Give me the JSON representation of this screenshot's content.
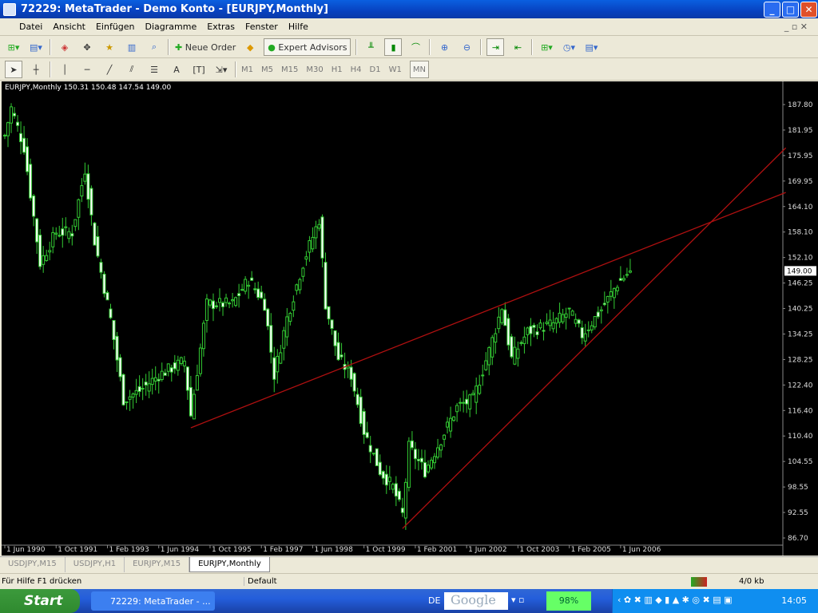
{
  "window": {
    "title": "72229: MetaTrader - Demo Konto - [EURJPY,Monthly]"
  },
  "menu": [
    "Datei",
    "Ansicht",
    "Einfügen",
    "Diagramme",
    "Extras",
    "Fenster",
    "Hilfe"
  ],
  "toolbar": {
    "new_order": "Neue Order",
    "expert_advisors": "Expert Advisors",
    "text_tool": "A",
    "timeframes": [
      "M1",
      "M5",
      "M15",
      "M30",
      "H1",
      "H4",
      "D1",
      "W1",
      "MN"
    ],
    "active_timeframe": "MN"
  },
  "chart_info": "EURJPY,Monthly  150.31 150.48 147.54 149.00",
  "current_price": "149.00",
  "price_axis": [
    "187.80",
    "181.95",
    "175.95",
    "169.95",
    "164.10",
    "158.10",
    "152.10",
    "146.25",
    "140.25",
    "134.25",
    "128.25",
    "122.40",
    "116.40",
    "110.40",
    "104.55",
    "98.55",
    "92.55",
    "86.70"
  ],
  "time_axis": [
    "1 Jun 1990",
    "1 Oct 1991",
    "1 Feb 1993",
    "1 Jun 1994",
    "1 Oct 1995",
    "1 Feb 1997",
    "1 Jun 1998",
    "1 Oct 1999",
    "1 Feb 2001",
    "1 Jun 2002",
    "1 Oct 2003",
    "1 Feb 2005",
    "1 Jun 2006"
  ],
  "tabs": [
    "USDJPY,M15",
    "USDJPY,H1",
    "EURJPY,M15",
    "EURJPY,Monthly"
  ],
  "active_tab": "EURJPY,Monthly",
  "status": {
    "help": "Für Hilfe F1 drücken",
    "profile": "Default",
    "traffic": "4/0 kb"
  },
  "taskbar": {
    "start": "Start",
    "task": "72229: MetaTrader - ...",
    "lang": "DE",
    "search": "Google",
    "battery": "98%",
    "clock": "14:05"
  },
  "chart_data": {
    "type": "candlestick",
    "symbol": "EURJPY",
    "timeframe": "Monthly",
    "ylim": [
      86.7,
      187.8
    ],
    "months_from": "Jun 1990",
    "close_anchors": [
      [
        0,
        180.5
      ],
      [
        2,
        187
      ],
      [
        6,
        177.8
      ],
      [
        11,
        150.8
      ],
      [
        16,
        158
      ],
      [
        21,
        158
      ],
      [
        25,
        172.7
      ],
      [
        28,
        156
      ],
      [
        33,
        137.7
      ],
      [
        37,
        119
      ],
      [
        42,
        121
      ],
      [
        48,
        124.7
      ],
      [
        56,
        128
      ],
      [
        58,
        115.3
      ],
      [
        63,
        141.3
      ],
      [
        71,
        141.3
      ],
      [
        76,
        147
      ],
      [
        81,
        141.3
      ],
      [
        84,
        124.7
      ],
      [
        88,
        138
      ],
      [
        93,
        150.8
      ],
      [
        98,
        161
      ],
      [
        100,
        141.3
      ],
      [
        104,
        128.5
      ],
      [
        108,
        124.7
      ],
      [
        112,
        111.6
      ],
      [
        117,
        102.3
      ],
      [
        121,
        98.6
      ],
      [
        124,
        92.1
      ],
      [
        126,
        107.9
      ],
      [
        131,
        102.3
      ],
      [
        136,
        109.7
      ],
      [
        141,
        117.2
      ],
      [
        146,
        119
      ],
      [
        151,
        130.4
      ],
      [
        155,
        140.6
      ],
      [
        158,
        128.5
      ],
      [
        163,
        134.8
      ],
      [
        171,
        136.7
      ],
      [
        176,
        139.6
      ],
      [
        180,
        134
      ],
      [
        186,
        140
      ],
      [
        191,
        146
      ],
      [
        195,
        149
      ]
    ],
    "trendlines": [
      {
        "from": [
          58,
          112.4
        ],
        "to": [
          243.5,
          167.3
        ],
        "color": "#b01010"
      },
      {
        "from": [
          124,
          88.9
        ],
        "to": [
          243.5,
          177.7
        ],
        "color": "#b01010"
      }
    ]
  }
}
